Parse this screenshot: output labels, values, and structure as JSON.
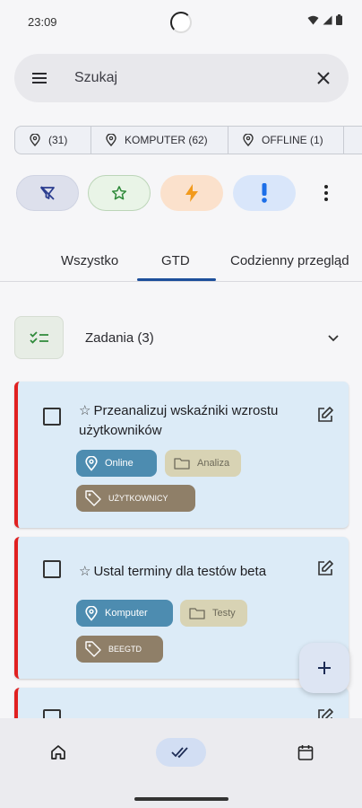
{
  "status": {
    "time": "23:09"
  },
  "search": {
    "placeholder": "Szukaj"
  },
  "location_chips": [
    {
      "label": "(31)"
    },
    {
      "label": "KOMPUTER (62)"
    },
    {
      "label": "OFFLINE (1)"
    }
  ],
  "filters": [
    {
      "icon": "filter-off-icon",
      "bg": "#dde0ec",
      "color": "#2a3c8f"
    },
    {
      "icon": "star-outline-icon",
      "bg": "#e9f4e7",
      "color": "#2f8a3a"
    },
    {
      "icon": "bolt-icon",
      "bg": "#fbe1cc",
      "color": "#f29a1c"
    },
    {
      "icon": "exclamation-icon",
      "bg": "#d9e6fa",
      "color": "#1d6fe8"
    }
  ],
  "tabs": [
    {
      "label": "Wszystko"
    },
    {
      "label": "GTD",
      "active": true
    },
    {
      "label": "Codzienny przegląd"
    }
  ],
  "section": {
    "title": "Zadania (3)"
  },
  "tasks": [
    {
      "title": "Przeanalizuj wskaźniki wzrostu użytkowników",
      "location": "Online",
      "folder": "Analiza",
      "label": "UŻYTKOWNICY"
    },
    {
      "title": "Ustal terminy dla testów beta",
      "location": "Komputer",
      "folder": "Testy",
      "label": "BEEGTD"
    }
  ],
  "colors": {
    "priority_bar": "#e02020",
    "card_bg": "#dcebf7",
    "accent": "#1d4f9b"
  },
  "nav": [
    {
      "icon": "home-icon"
    },
    {
      "icon": "double-check-icon",
      "active": true
    },
    {
      "icon": "calendar-icon"
    }
  ]
}
